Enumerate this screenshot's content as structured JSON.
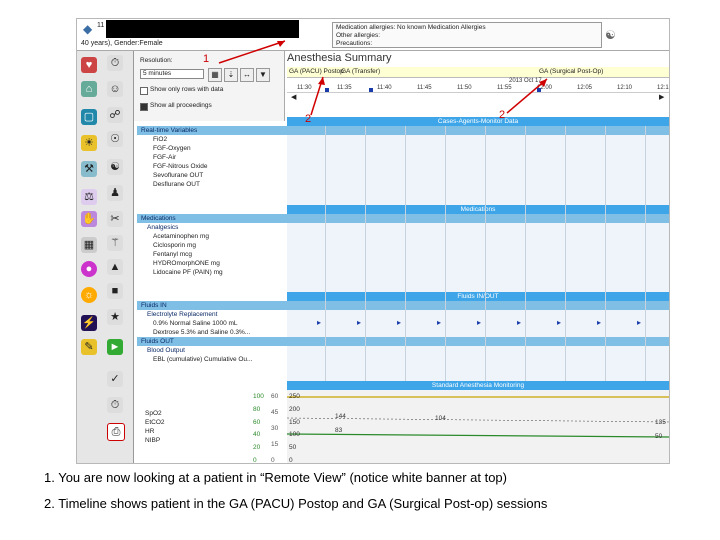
{
  "banner": {
    "patient_id_partial": "11",
    "demographics": "40 years), Gender:Female",
    "allergies_lines": [
      "Medication allergies: No known Medication Allergies",
      "Other allergies:",
      "Precautions:"
    ]
  },
  "annotations": {
    "num1": "1",
    "num2a": "2",
    "num2b": "2"
  },
  "left_panel": {
    "resolution_label": "Resolution:",
    "resolution_value": "5 minutes",
    "show_only_rows": "Show only rows with data",
    "show_all_proceedings": "Show all proceedings"
  },
  "title": "Anesthesia Summary",
  "sessions": {
    "session1": "GA (PACU) Postop",
    "session2": "GA (Transfer)",
    "session3": "GA (Surgical Post-Op)",
    "date": "2013 Oct 17"
  },
  "time_ticks": [
    "11:30",
    "11:35",
    "11:40",
    "11:45",
    "11:50",
    "11:55",
    "12:00",
    "12:05",
    "12:10",
    "12:15"
  ],
  "sections": {
    "cases": "Cases-Agents-Monitor Data",
    "medications": "Medications",
    "fluids": "Fluids IN/OUT",
    "monitoring": "Standard Anesthesia Monitoring"
  },
  "realtime_vars": {
    "header": "Real-time Variables",
    "items": [
      "FiO2",
      "FGF-Oxygen",
      "FGF-Air",
      "FGF-Nitrous Oxide",
      "Sevoflurane OUT",
      "Desflurane OUT"
    ]
  },
  "meds": {
    "header": "Medications",
    "sub": "Analgesics",
    "items": [
      "Acetaminophen mg",
      "Ciclosporin mg",
      "Fentanyl mcg",
      "HYDROmorphONE mg",
      "Lidocaine PF (PAIN) mg"
    ]
  },
  "fluids": {
    "header": "Fluids IN",
    "sub": "Electrolyte Replacement",
    "items": [
      "0.9% Normal Saline 1000 mL",
      "Dextrose 5.3% and Saline 0.3%..."
    ],
    "out_header": "Fluids OUT",
    "out_sub": "Blood Output",
    "out_items": [
      "EBL (cumulative) Cumulative Ou..."
    ]
  },
  "monitor": {
    "labels": [
      "SpO2",
      "EtCO2",
      "HR",
      "NIBP"
    ],
    "scale_left": [
      "100",
      "80",
      "60",
      "40",
      "20",
      "0"
    ],
    "scale_mid": [
      "60",
      "45",
      "30",
      "15",
      "0"
    ],
    "scale_right": [
      "250",
      "200",
      "150",
      "100",
      "50",
      "0"
    ],
    "values": [
      "144",
      "83",
      "135",
      "50",
      "104"
    ]
  },
  "notes": [
    "1.  You are now looking at a patient in “Remote View” (notice white banner at top)",
    "2.  Timeline shows patient in the GA (PACU) Postop and GA (Surgical Post-op) sessions"
  ]
}
